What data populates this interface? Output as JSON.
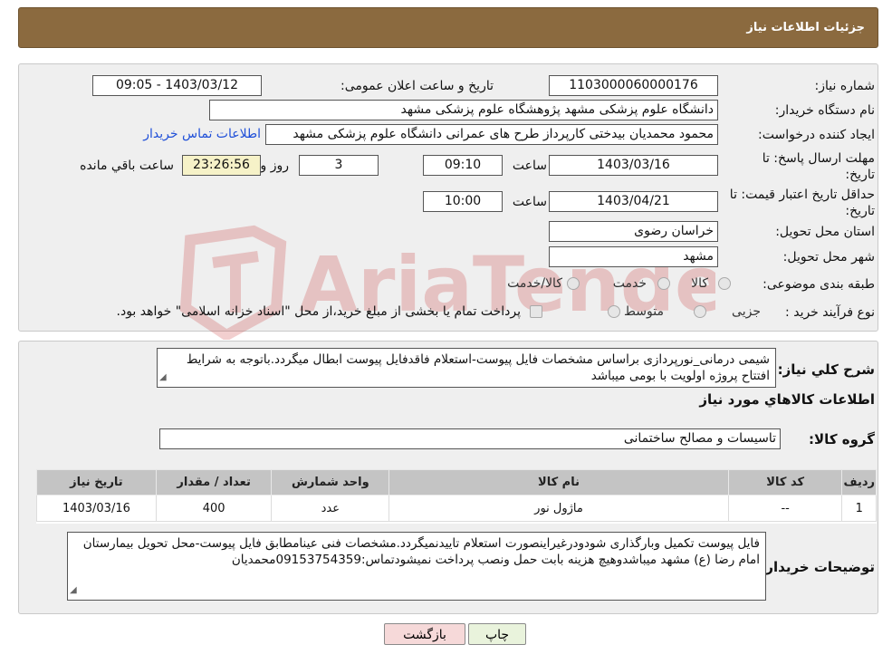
{
  "header": {
    "title": "جزئیات اطلاعات نیاز"
  },
  "form": {
    "need_number_label": "شماره نیاز:",
    "need_number": "1103000060000176",
    "announce_label": "تاریخ و ساعت اعلان عمومی:",
    "announce_value": "1403/03/12 - 09:05",
    "buyer_org_label": "نام دستگاه خریدار:",
    "buyer_org": "دانشگاه علوم پزشکی مشهد   پژوهشگاه علوم پزشکی مشهد",
    "requester_label": "ایجاد کننده درخواست:",
    "requester": "محمود محمدیان بیدختی کارپرداز طرح های عمرانی دانشگاه علوم پزشکی مشهد",
    "contact_link": "اطلاعات تماس خریدار",
    "reply_deadline_label": "مهلت ارسال پاسخ: تا تاریخ:",
    "reply_date": "1403/03/16",
    "time_label": "ساعت",
    "reply_time": "09:10",
    "days_value": "3",
    "days_label": "روز و",
    "remaining_time": "23:26:56",
    "remaining_label": "ساعت باقي مانده",
    "price_validity_label": "حداقل تاریخ اعتبار قیمت: تا تاریخ:",
    "price_date": "1403/04/21",
    "price_time": "10:00",
    "province_label": "استان محل تحویل:",
    "province": "خراسان رضوی",
    "city_label": "شهر محل تحویل:",
    "city": "مشهد",
    "category_label": "طبقه بندی موضوعی:",
    "category_options": [
      "کالا",
      "خدمت",
      "کالا/خدمت"
    ],
    "process_label": "نوع فرآیند خرید :",
    "process_options": [
      "جزیی",
      "متوسط"
    ],
    "process_note": "پرداخت تمام یا بخشی از مبلغ خرید،از محل \"اسناد خزانه اسلامی\" خواهد بود."
  },
  "details": {
    "summary_label": "شرح کلي نياز:",
    "summary_text": "شیمی درمانی_نورپردازی براساس مشخصات فایل پیوست-استعلام فاقدفایل پیوست ابطال میگردد.باتوجه به شرایط افتتاح پروژه اولویت با بومی میباشد",
    "goods_info_title": "اطلاعات کالاهاي مورد نياز",
    "goods_group_label": "گروه کالا:",
    "goods_group": "تاسیسات و مصالح ساختمانی",
    "table": {
      "headers": [
        "رديف",
        "کد کالا",
        "نام کالا",
        "واحد شمارش",
        "تعداد / مقدار",
        "تاریخ نیاز"
      ],
      "rows": [
        [
          "1",
          "--",
          "ماژول نور",
          "عدد",
          "400",
          "1403/03/16"
        ]
      ]
    },
    "buyer_notes_label": "توضيحات خريدار:",
    "buyer_notes": "فایل پیوست تکمیل وبارگذاری شودودرغیراینصورت استعلام تاییدنمیگردد.مشخصات فنی عینامطابق فایل پیوست-محل تحویل بیمارستان امام رضا (ع) مشهد میباشدوهیچ هزینه بابت حمل ونصب پرداخت نمیشودتماس:09153754359محمدیان"
  },
  "buttons": {
    "print": "چاپ",
    "back": "بازگشت"
  },
  "watermark": {
    "text": "AriaTender.neT",
    "color": "#c62828"
  }
}
